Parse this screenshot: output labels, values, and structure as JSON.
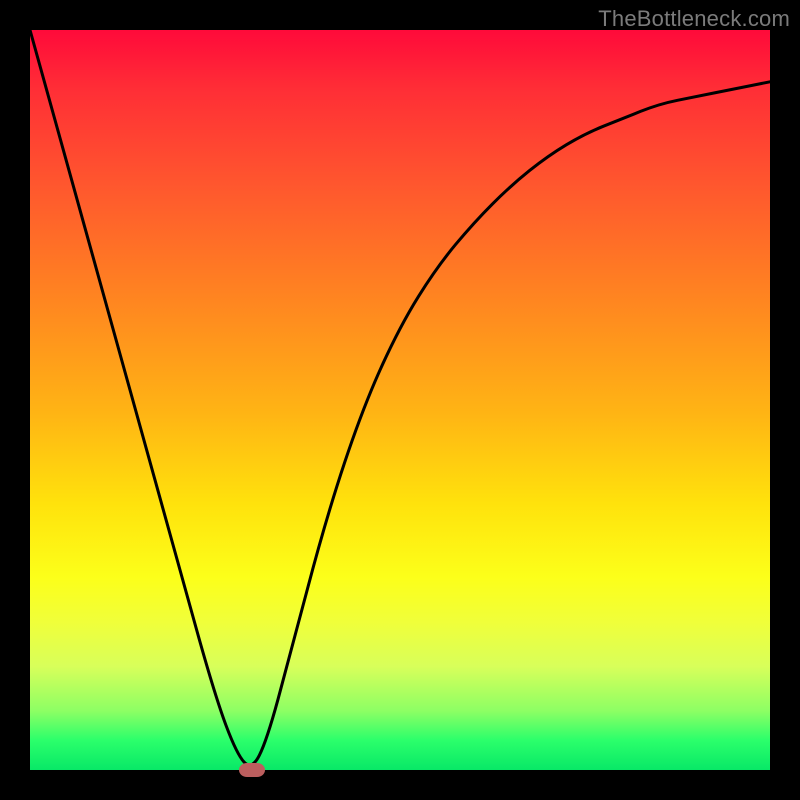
{
  "watermark": "TheBottleneck.com",
  "chart_data": {
    "type": "line",
    "title": "",
    "xlabel": "",
    "ylabel": "",
    "xlim": [
      0,
      100
    ],
    "ylim": [
      0,
      100
    ],
    "grid": false,
    "legend": false,
    "series": [
      {
        "name": "curve",
        "x": [
          0,
          5,
          10,
          15,
          20,
          25,
          28,
          30,
          32,
          35,
          40,
          45,
          50,
          55,
          60,
          65,
          70,
          75,
          80,
          85,
          90,
          95,
          100
        ],
        "y": [
          100,
          82,
          64,
          46,
          28,
          10,
          2,
          0,
          4,
          15,
          34,
          49,
          60,
          68,
          74,
          79,
          83,
          86,
          88,
          90,
          91,
          92,
          93
        ]
      }
    ],
    "marker": {
      "x": 30,
      "y": 0
    },
    "background_gradient": {
      "type": "vertical",
      "stops": [
        {
          "pos": 0,
          "color": "#ff0a3a"
        },
        {
          "pos": 50,
          "color": "#ffb514"
        },
        {
          "pos": 75,
          "color": "#fcff1a"
        },
        {
          "pos": 100,
          "color": "#08e867"
        }
      ]
    }
  }
}
